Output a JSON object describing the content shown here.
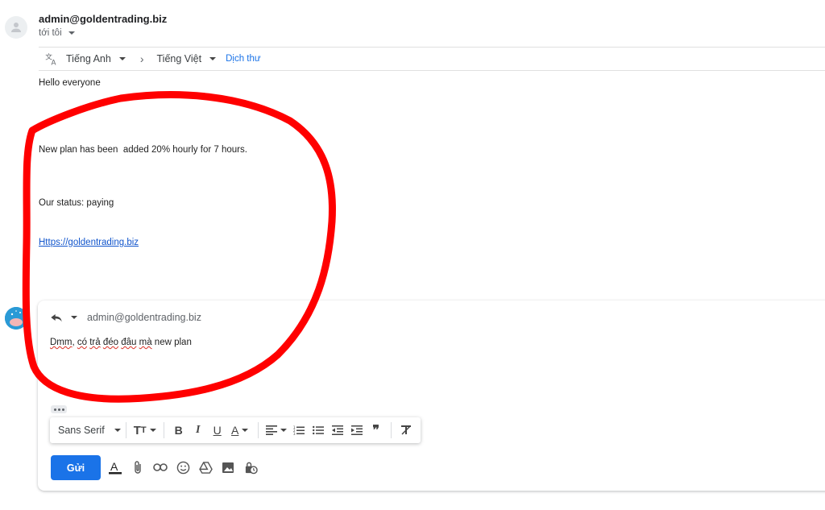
{
  "header": {
    "sender": "admin@goldentrading.biz",
    "recipient_label": "tới tôi"
  },
  "translate_bar": {
    "source_language": "Tiếng Anh",
    "target_language": "Tiếng Việt",
    "translate_link": "Dịch thư"
  },
  "message": {
    "greeting": "Hello everyone",
    "line1": "New plan has been  added 20% hourly for 7 hours.",
    "line2": "Our status: paying",
    "link": "Https://goldentrading.biz"
  },
  "reply": {
    "to": "admin@goldentrading.biz",
    "words": [
      "Dmm",
      ", ",
      "có",
      " ",
      "trả",
      " ",
      "đéo",
      " ",
      "đâu",
      " ",
      "mà",
      " new plan"
    ],
    "font_name": "Sans Serif",
    "send_label": "Gửi"
  },
  "colors": {
    "accent": "#1a73e8",
    "annotation": "#ff0000",
    "link": "#1155cc"
  }
}
